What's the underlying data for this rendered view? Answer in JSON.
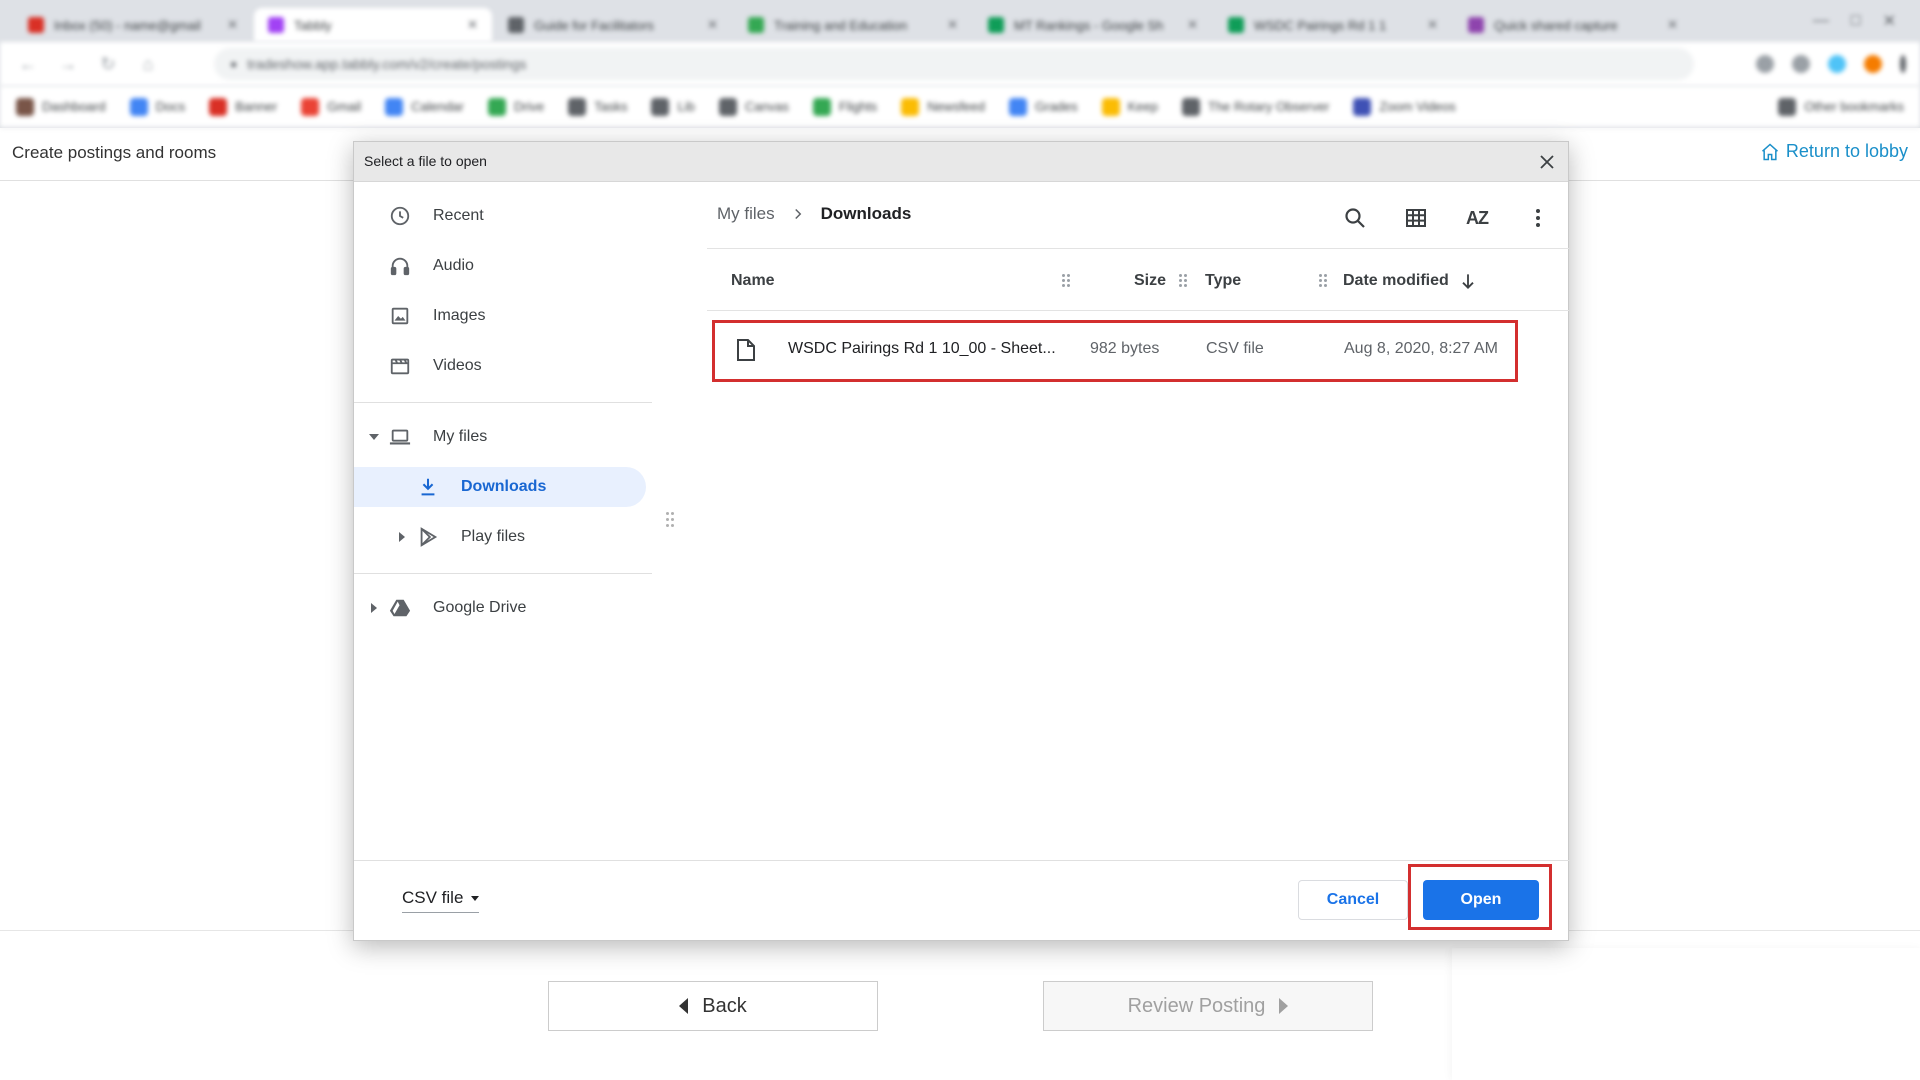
{
  "browser": {
    "tabs": [
      {
        "title": "Inbox (50) - name@gmail",
        "color": "#d93025"
      },
      {
        "title": "Tabbly",
        "color": "#a142f4"
      },
      {
        "title": "Guide for Facilitators",
        "color": "#5f6368"
      },
      {
        "title": "Training and Education",
        "color": "#34a853"
      },
      {
        "title": "MT Rankings - Google Sh",
        "color": "#0f9d58"
      },
      {
        "title": "WSDC Pairings Rd 1 1",
        "color": "#0f9d58"
      },
      {
        "title": "Quick shared capture",
        "color": "#8e44ad"
      }
    ],
    "url": "tradeshow.app.tabbly.com/v2/create/postings",
    "bookmarks": [
      {
        "label": "Dashboard",
        "color": "#795548"
      },
      {
        "label": "Docs",
        "color": "#4285f4"
      },
      {
        "label": "Banner",
        "color": "#d93025"
      },
      {
        "label": "Gmail",
        "color": "#ea4335"
      },
      {
        "label": "Calendar",
        "color": "#4285f4"
      },
      {
        "label": "Drive",
        "color": "#34a853"
      },
      {
        "label": "Tasks",
        "color": "#5f6368"
      },
      {
        "label": "Lib",
        "color": "#5f6368"
      },
      {
        "label": "Canvas",
        "color": "#5f6368"
      },
      {
        "label": "Flights",
        "color": "#34a853"
      },
      {
        "label": "Newsfeed",
        "color": "#fbbc04"
      },
      {
        "label": "Grades",
        "color": "#4285f4"
      },
      {
        "label": "Keep",
        "color": "#fbbc04"
      },
      {
        "label": "The Rotary Observer",
        "color": "#5f6368"
      },
      {
        "label": "Zoom Videos",
        "color": "#3f51b5"
      },
      {
        "label": "Other bookmarks",
        "color": "#5f6368"
      }
    ]
  },
  "page": {
    "title": "Create postings and rooms",
    "return_link": "Return to lobby",
    "back_label": "Back",
    "review_label": "Review Posting"
  },
  "dialog": {
    "title": "Select a file to open",
    "sidebar": {
      "recent": "Recent",
      "audio": "Audio",
      "images": "Images",
      "videos": "Videos",
      "my_files": "My files",
      "downloads": "Downloads",
      "play_files": "Play files",
      "google_drive": "Google Drive"
    },
    "breadcrumb": {
      "root": "My files",
      "current": "Downloads"
    },
    "sort_label": "AZ",
    "columns": {
      "name": "Name",
      "size": "Size",
      "type": "Type",
      "date": "Date modified"
    },
    "files": [
      {
        "name": "WSDC Pairings Rd 1 10_00 - Sheet...",
        "size": "982 bytes",
        "type": "CSV file",
        "date": "Aug 8, 2020, 8:27 AM"
      }
    ],
    "file_type_filter": "CSV file",
    "cancel_label": "Cancel",
    "open_label": "Open"
  },
  "colors": {
    "accent": "#1a73e8",
    "highlight": "#d32f2f",
    "link": "#1a8fc9"
  }
}
